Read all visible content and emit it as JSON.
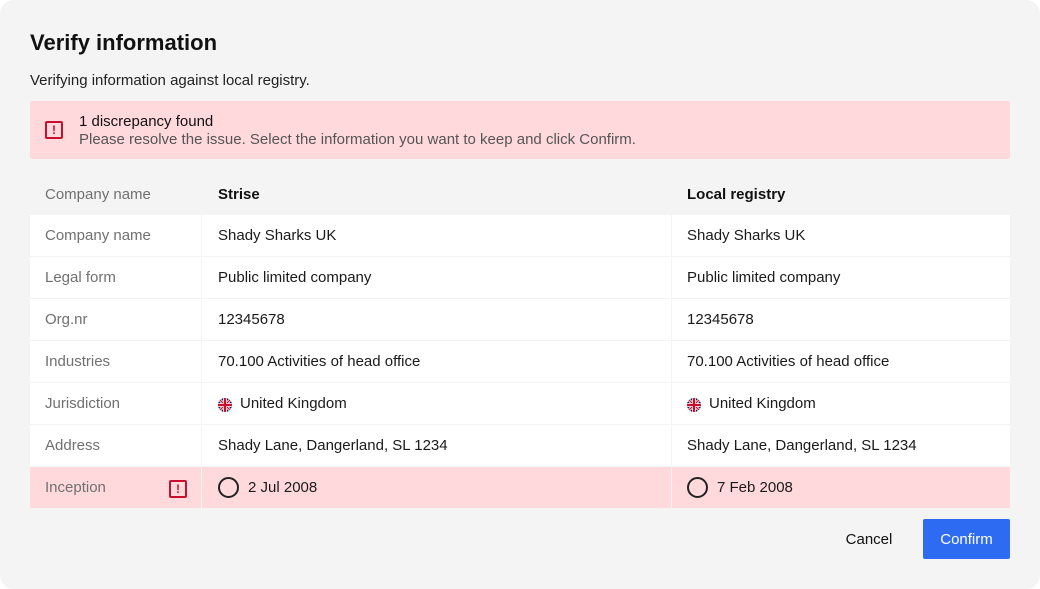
{
  "dialog": {
    "title": "Verify information",
    "subtitle": "Verifying information against local registry."
  },
  "alert": {
    "icon": "warning-square-icon",
    "title": "1 discrepancy found",
    "message": "Please resolve the issue. Select the information you want to keep and click Confirm."
  },
  "table": {
    "headers": {
      "label": "Company name",
      "strise": "Strise",
      "registry": "Local registry"
    },
    "rows": [
      {
        "label": "Company name",
        "strise": "Shady Sharks UK",
        "registry": "Shady Sharks UK"
      },
      {
        "label": "Legal form",
        "strise": "Public limited company",
        "registry": "Public limited company"
      },
      {
        "label": "Org.nr",
        "strise": "12345678",
        "registry": "12345678"
      },
      {
        "label": "Industries",
        "strise": "70.100 Activities of head office",
        "registry": "70.100 Activities of head office"
      },
      {
        "label": "Jurisdiction",
        "strise": "United Kingdom",
        "registry": "United Kingdom",
        "flag": "uk-flag-icon"
      },
      {
        "label": "Address",
        "strise": "Shady Lane, Dangerland, SL 1234",
        "registry": "Shady Lane, Dangerland, SL 1234"
      },
      {
        "label": "Inception",
        "strise": "2 Jul 2008",
        "registry": "7 Feb 2008",
        "conflict": true
      }
    ]
  },
  "footer": {
    "cancel_label": "Cancel",
    "confirm_label": "Confirm"
  },
  "colors": {
    "accent": "#2d6bf3",
    "alert_bg": "#ffd9dc",
    "alert_icon": "#c8102e",
    "background": "#f4f4f4"
  }
}
